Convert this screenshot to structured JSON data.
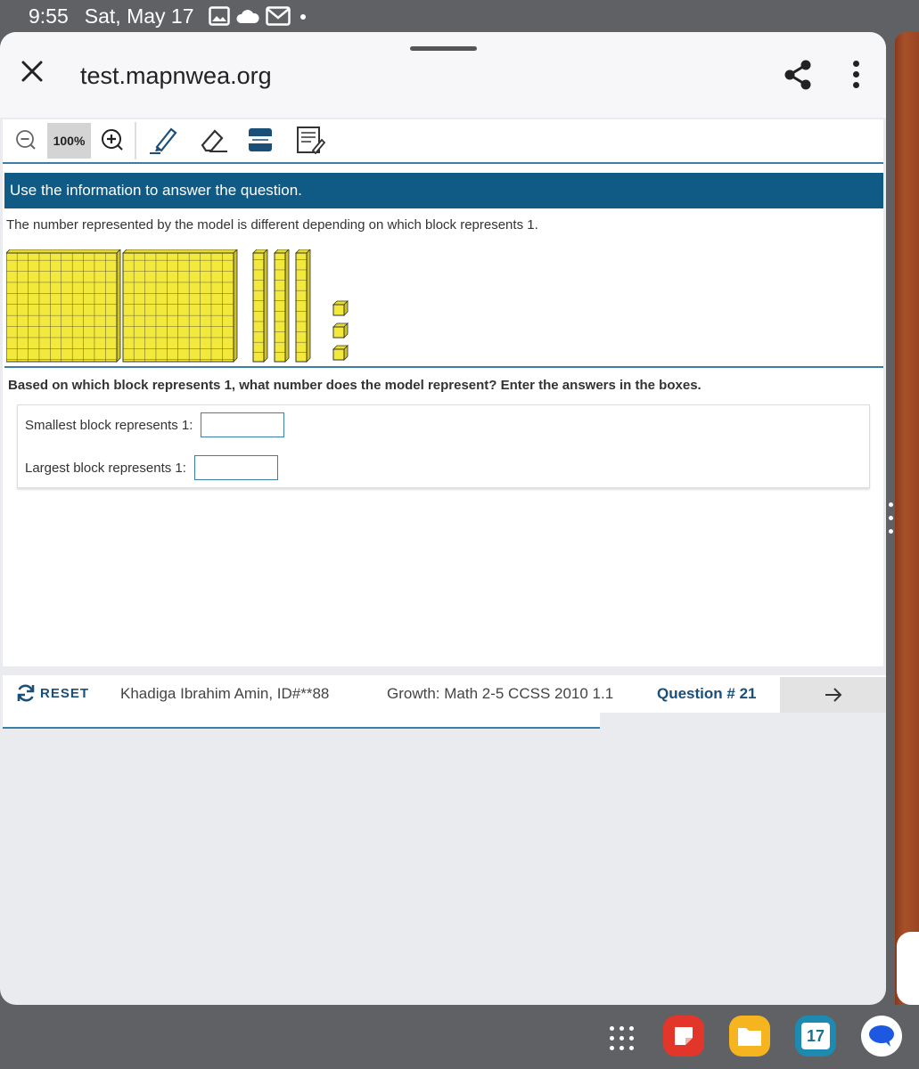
{
  "status_bar": {
    "time": "9:55",
    "date": "Sat, May 17",
    "icons": [
      "gallery-icon",
      "cloud-icon",
      "gmail-icon",
      "dot-icon"
    ]
  },
  "browser": {
    "url": "test.mapnwea.org",
    "icons": [
      "close-icon",
      "share-icon",
      "more-vert-icon"
    ]
  },
  "toolbar": {
    "zoom_level": "100%",
    "tools": [
      "zoom-out-icon",
      "zoom-in-icon",
      "highlighter-icon",
      "eraser-icon",
      "line-reader-icon",
      "notepad-icon"
    ]
  },
  "content": {
    "instruction": "Use the information to answer the question.",
    "stimulus": "The number represented by the model is different depending on which block represents 1.",
    "model": {
      "large_blocks": 2,
      "long_blocks": 3,
      "small_blocks": 3
    },
    "question": "Based on which block represents 1, what number does the model represent? Enter the answers in the boxes.",
    "answers": [
      {
        "label": "Smallest block represents 1:",
        "value": ""
      },
      {
        "label": "Largest block represents 1:",
        "value": ""
      }
    ]
  },
  "footer": {
    "reset_label": "RESET",
    "student": "Khadiga Ibrahim Amin, ID#**88",
    "test_name": "Growth: Math 2-5 CCSS 2010 1.1",
    "question_number": "Question # 21"
  },
  "colors": {
    "instruction_bar": "#0f5b86",
    "accent": "#3c7fa6",
    "block_fill": "#f3e83c",
    "nav_text": "#1a4f78"
  },
  "taskbar": {
    "apps": [
      "app-drawer-icon",
      "notes-app-icon",
      "files-app-icon",
      "calendar-app-icon",
      "messages-app-icon"
    ],
    "calendar_day": "17"
  }
}
